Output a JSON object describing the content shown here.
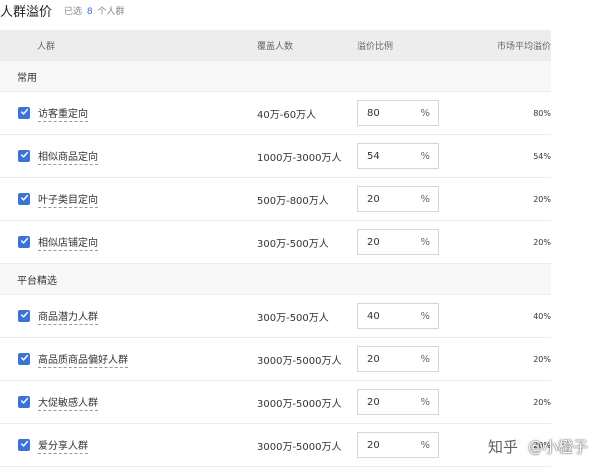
{
  "header": {
    "title": "人群溢价",
    "selected_prefix": "已选",
    "selected_count": "8",
    "selected_suffix": "个人群"
  },
  "table": {
    "columns": {
      "name": "人群",
      "cover": "覆盖人数",
      "ratio": "溢价比例",
      "market": "市场平均溢价"
    },
    "groups": [
      {
        "label": "常用",
        "rows": [
          {
            "name": "访客重定向",
            "cover": "40万-60万人",
            "ratio": "80",
            "unit": "%",
            "market": "80%",
            "checked": true
          },
          {
            "name": "相似商品定向",
            "cover": "1000万-3000万人",
            "ratio": "54",
            "unit": "%",
            "market": "54%",
            "checked": true
          },
          {
            "name": "叶子类目定向",
            "cover": "500万-800万人",
            "ratio": "20",
            "unit": "%",
            "market": "20%",
            "checked": true
          },
          {
            "name": "相似店铺定向",
            "cover": "300万-500万人",
            "ratio": "20",
            "unit": "%",
            "market": "20%",
            "checked": true
          }
        ]
      },
      {
        "label": "平台精选",
        "rows": [
          {
            "name": "商品潜力人群",
            "cover": "300万-500万人",
            "ratio": "40",
            "unit": "%",
            "market": "40%",
            "checked": true
          },
          {
            "name": "高品质商品偏好人群",
            "cover": "3000万-5000万人",
            "ratio": "20",
            "unit": "%",
            "market": "20%",
            "checked": true
          },
          {
            "name": "大促敏感人群",
            "cover": "3000万-5000万人",
            "ratio": "20",
            "unit": "%",
            "market": "20%",
            "checked": true
          },
          {
            "name": "爱分享人群",
            "cover": "3000万-5000万人",
            "ratio": "20",
            "unit": "%",
            "market": "20%",
            "checked": true
          }
        ]
      }
    ]
  },
  "watermark": {
    "site": "知乎",
    "author": "@小橙子"
  },
  "colors": {
    "accent": "#3e73d6",
    "header_bg": "#ededed"
  }
}
